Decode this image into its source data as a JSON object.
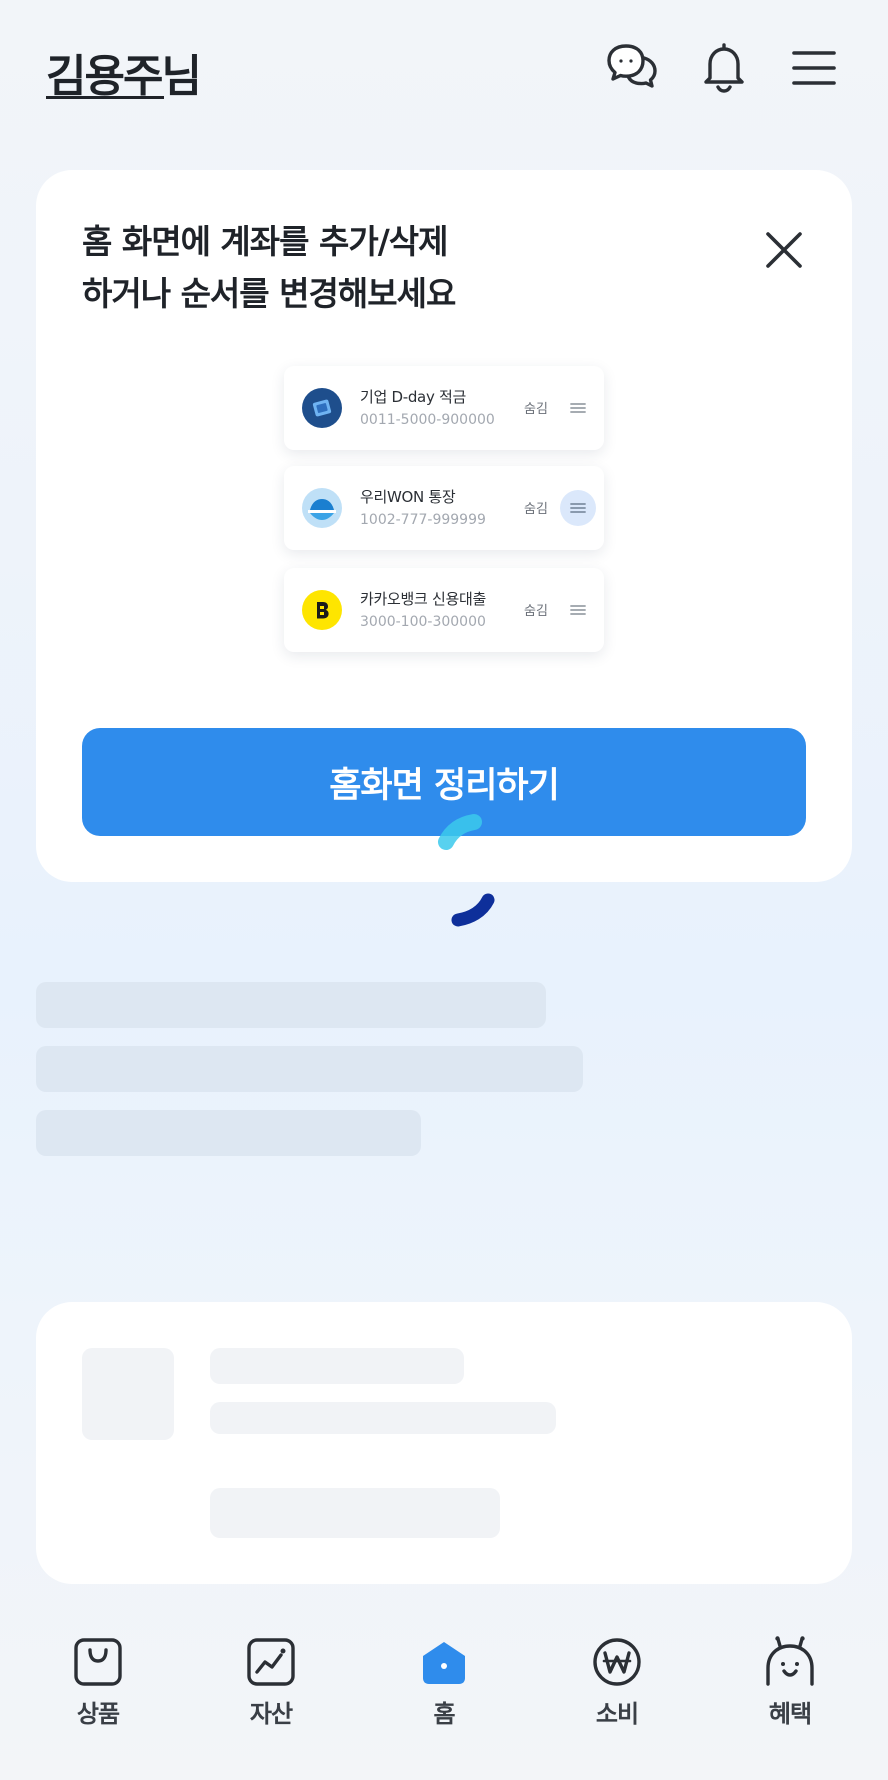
{
  "header": {
    "user_name": "김용주님",
    "icons": [
      "chat-icon",
      "bell-icon",
      "menu-icon"
    ]
  },
  "promo": {
    "title_line1": "홈 화면에 계좌를 추가/삭제",
    "title_line2": "하거나 순서를 변경해보세요",
    "accounts": [
      {
        "name": "기업 D-day 적금",
        "number": "0011-5000-900000",
        "hide_label": "숨김",
        "logo_color": "#1e4e8c"
      },
      {
        "name": "우리WON 통장",
        "number": "1002-777-999999",
        "hide_label": "숨김",
        "logo_color": "#bfe0f7"
      },
      {
        "name": "카카오뱅크 신용대출",
        "number": "3000-100-300000",
        "hide_label": "숨김",
        "logo_color": "#fee500"
      }
    ],
    "button_label": "홈화면 정리하기"
  },
  "tabs": [
    {
      "label": "상품",
      "icon": "shopping-bag-icon"
    },
    {
      "label": "자산",
      "icon": "chart-icon"
    },
    {
      "label": "홈",
      "icon": "home-icon",
      "active": true
    },
    {
      "label": "소비",
      "icon": "won-icon"
    },
    {
      "label": "혜택",
      "icon": "benefit-character-icon"
    }
  ],
  "colors": {
    "accent": "#2f8cec",
    "text": "#1f2329",
    "card": "#ffffff"
  }
}
